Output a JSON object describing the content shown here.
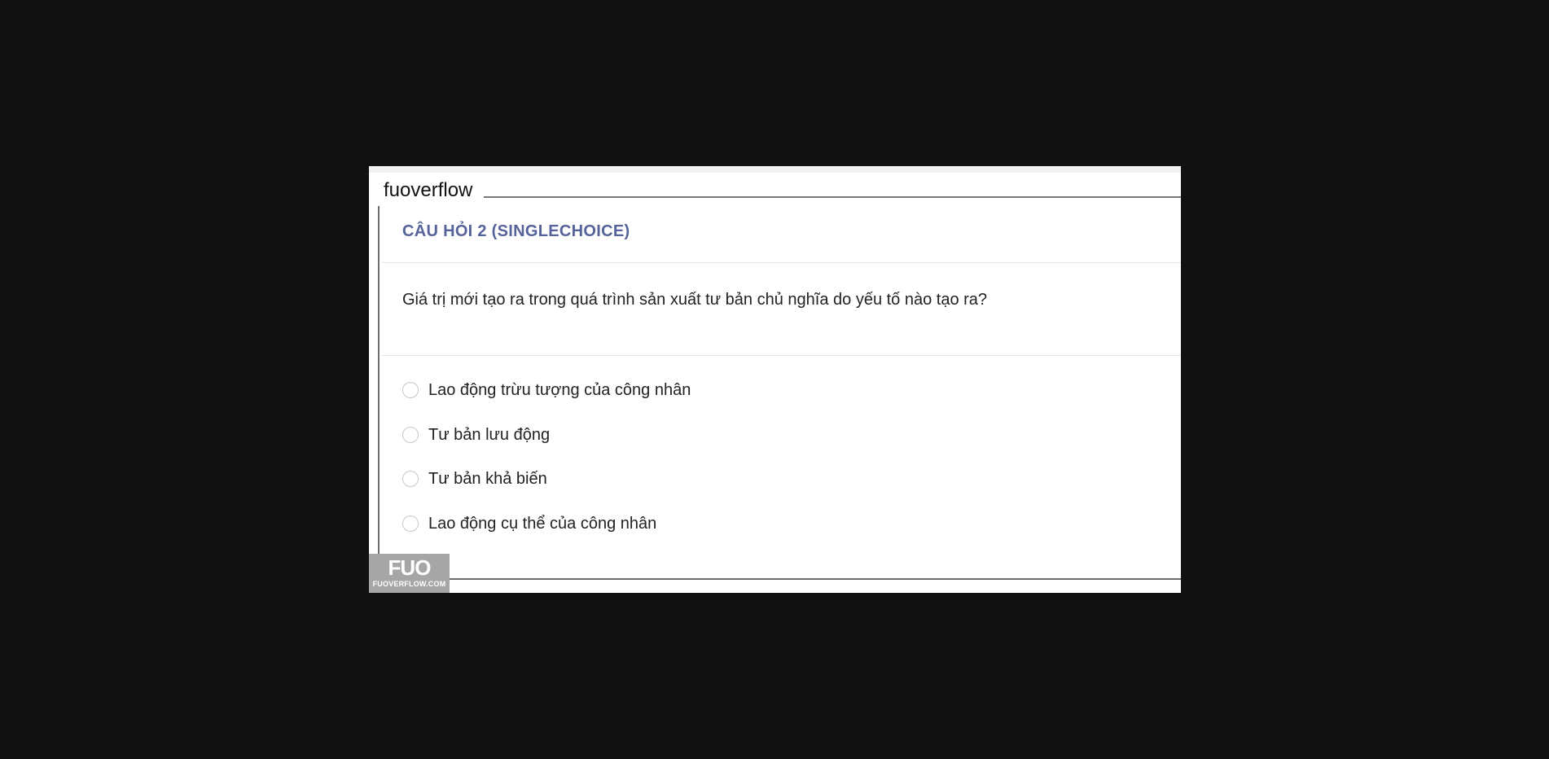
{
  "site": {
    "label": "fuoverflow"
  },
  "question": {
    "title": "CÂU HỎI 2 (SINGLECHOICE)",
    "text": "Giá trị mới tạo ra trong quá trình sản xuất tư bản chủ nghĩa do yếu tố nào tạo ra?",
    "options": [
      {
        "label": "Lao động trừu tượng của công nhân",
        "selected": false
      },
      {
        "label": "Tư bản lưu động",
        "selected": false
      },
      {
        "label": "Tư bản khả biến",
        "selected": false
      },
      {
        "label": "Lao động cụ thể của công nhân",
        "selected": false
      }
    ]
  },
  "logo": {
    "mark": "FUO",
    "domain": "FUOVERFLOW.COM"
  },
  "colors": {
    "backdrop": "#111111",
    "title": "#56639a",
    "logo_bg": "#a6a6a6"
  }
}
